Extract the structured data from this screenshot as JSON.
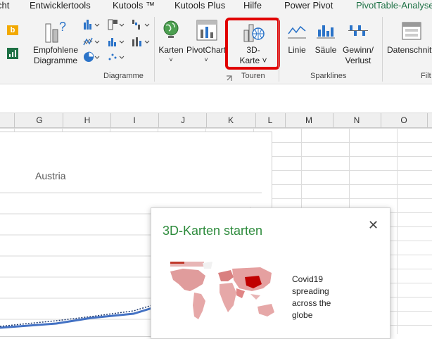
{
  "tabs": [
    "cht",
    "Entwicklertools",
    "Kutools ™",
    "Kutools Plus",
    "Hilfe",
    "Power Pivot",
    "PivotTable-Analyse"
  ],
  "ribbon": {
    "recommended_charts": "Empfohlene\nDiagramme",
    "maps": "Karten",
    "pivotchart": "PivotChart",
    "map3d": "3D-\nKarte ˅",
    "line": "Linie",
    "column": "Säule",
    "winloss": "Gewinn/\nVerlust",
    "data_slicer": "Datenschnitt"
  },
  "groups": {
    "charts": "Diagramme",
    "tours": "Touren",
    "sparklines": "Sparklines",
    "filter": "Filt"
  },
  "columns": [
    "G",
    "H",
    "I",
    "J",
    "K",
    "L",
    "M",
    "N",
    "O"
  ],
  "chart": {
    "title": "Austria"
  },
  "popup": {
    "title": "3D-Karten starten",
    "close": "✕",
    "description": "Covid19 spreading across the globe"
  },
  "colors": {
    "accent": "#1e7145",
    "highlight": "#e10000",
    "popup_title": "#2d8b3c"
  }
}
